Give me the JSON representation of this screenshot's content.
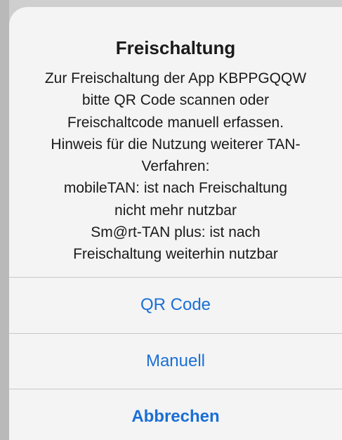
{
  "alert": {
    "title": "Freischaltung",
    "message_lines": [
      "Zur Freischaltung der App KBPPGQQW",
      "bitte QR Code scannen oder",
      "Freischaltcode manuell erfassen.",
      "Hinweis für die Nutzung weiterer TAN-",
      "Verfahren:",
      "mobileTAN: ist nach Freischaltung",
      "nicht mehr nutzbar",
      "Sm@rt-TAN plus: ist nach",
      "Freischaltung weiterhin nutzbar"
    ],
    "actions": {
      "qr_code": "QR Code",
      "manual": "Manuell",
      "cancel": "Abbrechen"
    },
    "colors": {
      "action_blue": "#1a6fd6",
      "background": "#f4f4f4",
      "divider": "#c8c8cc"
    }
  }
}
